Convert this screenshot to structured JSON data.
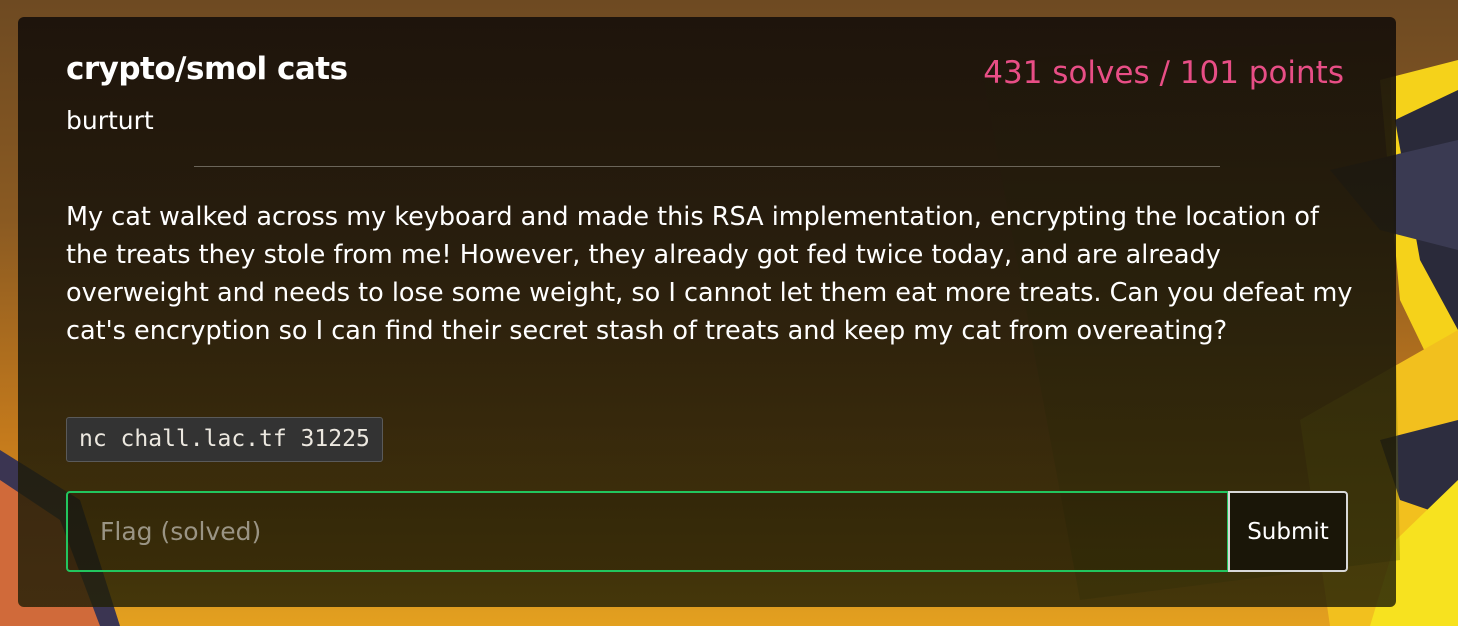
{
  "challenge": {
    "title": "crypto/smol cats",
    "author": "burturt",
    "stats": "431 solves / 101 points",
    "description": "My cat walked across my keyboard and made this RSA implementation, encrypting the location of the treats they stole from me! However, they already got fed twice today, and are already overweight and needs to lose some weight, so I cannot let them eat more treats. Can you defeat my cat's encryption so I can find their secret stash of treats and keep my cat from overeating?",
    "connection": "nc chall.lac.tf 31225"
  },
  "flag_form": {
    "placeholder": "Flag (solved)",
    "value": "",
    "submit_label": "Submit"
  },
  "colors": {
    "accent_pink": "#e84e86",
    "input_border_green": "#22c55e",
    "background_gold": "#e3a01f"
  }
}
